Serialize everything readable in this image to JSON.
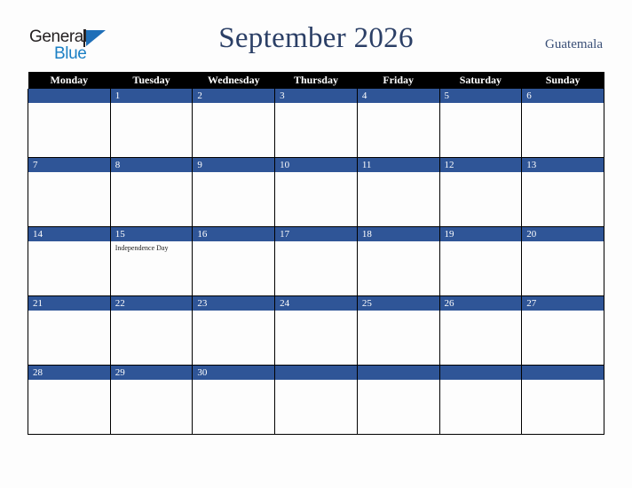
{
  "brand": {
    "name_top": "General",
    "name_bottom": "Blue",
    "triangle_icon": "triangle-icon",
    "colors": {
      "top_text": "#231f20",
      "bottom_text": "#1b7fc4",
      "triangle": "#1f6fb8"
    }
  },
  "header": {
    "title": "September 2026",
    "country": "Guatemala",
    "title_color": "#2b3f66",
    "country_color": "#3a4f77"
  },
  "calendar": {
    "accent_color": "#2f5597",
    "header_bg": "#000000",
    "header_text": "#ffffff",
    "cell_bg": "#fdfdfd",
    "weekday_headers": [
      "Monday",
      "Tuesday",
      "Wednesday",
      "Thursday",
      "Friday",
      "Saturday",
      "Sunday"
    ],
    "weeks": [
      [
        {
          "date": "",
          "events": []
        },
        {
          "date": "1",
          "events": []
        },
        {
          "date": "2",
          "events": []
        },
        {
          "date": "3",
          "events": []
        },
        {
          "date": "4",
          "events": []
        },
        {
          "date": "5",
          "events": []
        },
        {
          "date": "6",
          "events": []
        }
      ],
      [
        {
          "date": "7",
          "events": []
        },
        {
          "date": "8",
          "events": []
        },
        {
          "date": "9",
          "events": []
        },
        {
          "date": "10",
          "events": []
        },
        {
          "date": "11",
          "events": []
        },
        {
          "date": "12",
          "events": []
        },
        {
          "date": "13",
          "events": []
        }
      ],
      [
        {
          "date": "14",
          "events": []
        },
        {
          "date": "15",
          "events": [
            "Independence Day"
          ]
        },
        {
          "date": "16",
          "events": []
        },
        {
          "date": "17",
          "events": []
        },
        {
          "date": "18",
          "events": []
        },
        {
          "date": "19",
          "events": []
        },
        {
          "date": "20",
          "events": []
        }
      ],
      [
        {
          "date": "21",
          "events": []
        },
        {
          "date": "22",
          "events": []
        },
        {
          "date": "23",
          "events": []
        },
        {
          "date": "24",
          "events": []
        },
        {
          "date": "25",
          "events": []
        },
        {
          "date": "26",
          "events": []
        },
        {
          "date": "27",
          "events": []
        }
      ],
      [
        {
          "date": "28",
          "events": []
        },
        {
          "date": "29",
          "events": []
        },
        {
          "date": "30",
          "events": []
        },
        {
          "date": "",
          "events": []
        },
        {
          "date": "",
          "events": []
        },
        {
          "date": "",
          "events": []
        },
        {
          "date": "",
          "events": []
        }
      ]
    ]
  }
}
